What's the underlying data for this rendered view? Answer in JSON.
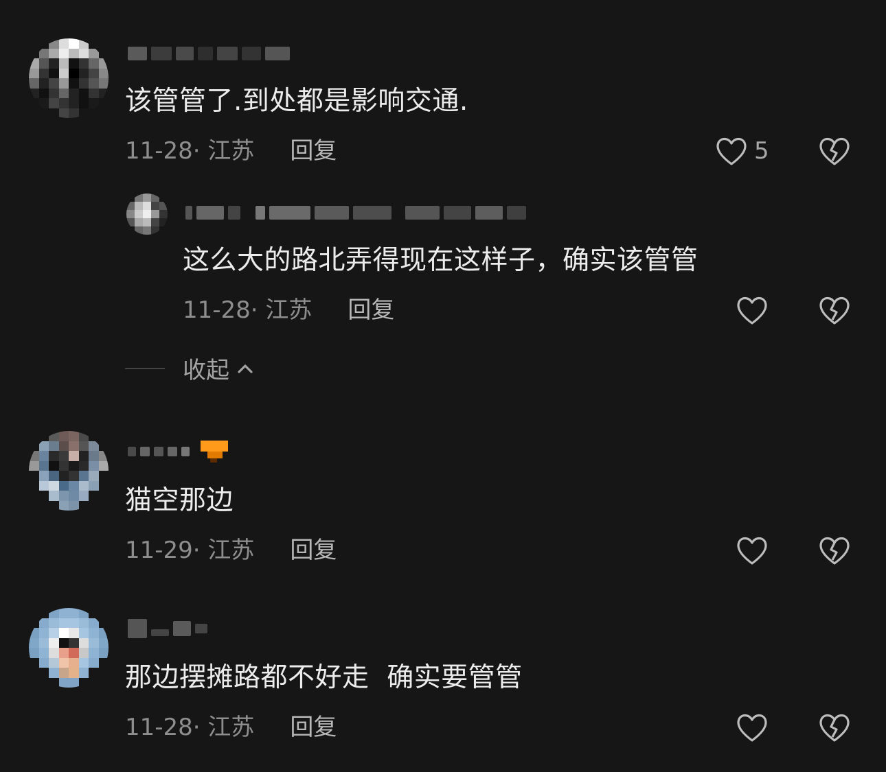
{
  "comments": [
    {
      "text": "该管管了.到处都是影响交通.",
      "date": "11-28",
      "location": "· 江苏",
      "reply_label": "回复",
      "like_count": "5",
      "reply": {
        "text": "这么大的路北弄得现在这样子，确实该管管",
        "date": "11-28",
        "location": "· 江苏",
        "reply_label": "回复"
      },
      "collapse_label": "收起"
    },
    {
      "text": "猫空那边",
      "date": "11-29",
      "location": "· 江苏",
      "reply_label": "回复"
    },
    {
      "text": "那边摆摊路都不好走  确实要管管",
      "date": "11-28",
      "location": "· 江苏",
      "reply_label": "回复"
    }
  ],
  "colors": {
    "background": "#161616",
    "text": "#ececec",
    "meta": "#8e8e8e",
    "icon": "#bdbdbd",
    "badge": "#ff8a00"
  },
  "icons": [
    "heart-outline-icon",
    "broken-heart-icon",
    "chevron-up-icon"
  ]
}
